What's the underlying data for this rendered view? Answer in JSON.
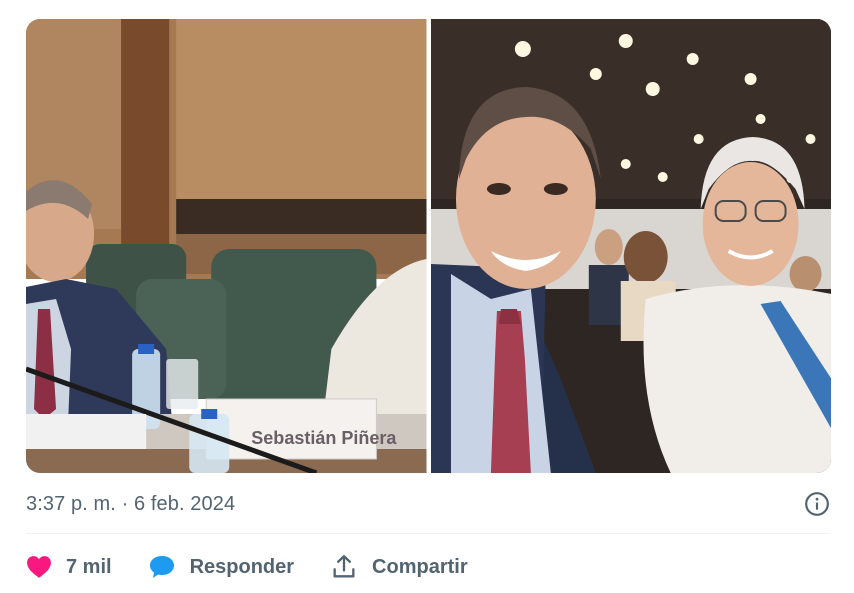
{
  "tweet": {
    "timestamp": "3:37 p. m. · 6 feb. 2024",
    "photos": [
      {
        "nameplate": "Sebastián Piñera"
      },
      {}
    ]
  },
  "actions": {
    "like": {
      "count": "7 mil",
      "icon": "heart-icon",
      "color": "#f91880"
    },
    "reply": {
      "label": "Responder",
      "icon": "speech-bubble-icon",
      "color": "#1d9bf0"
    },
    "share": {
      "label": "Compartir",
      "icon": "share-upload-icon"
    }
  },
  "colors": {
    "secondary_text": "#536471",
    "divider": "#eff3f4"
  }
}
